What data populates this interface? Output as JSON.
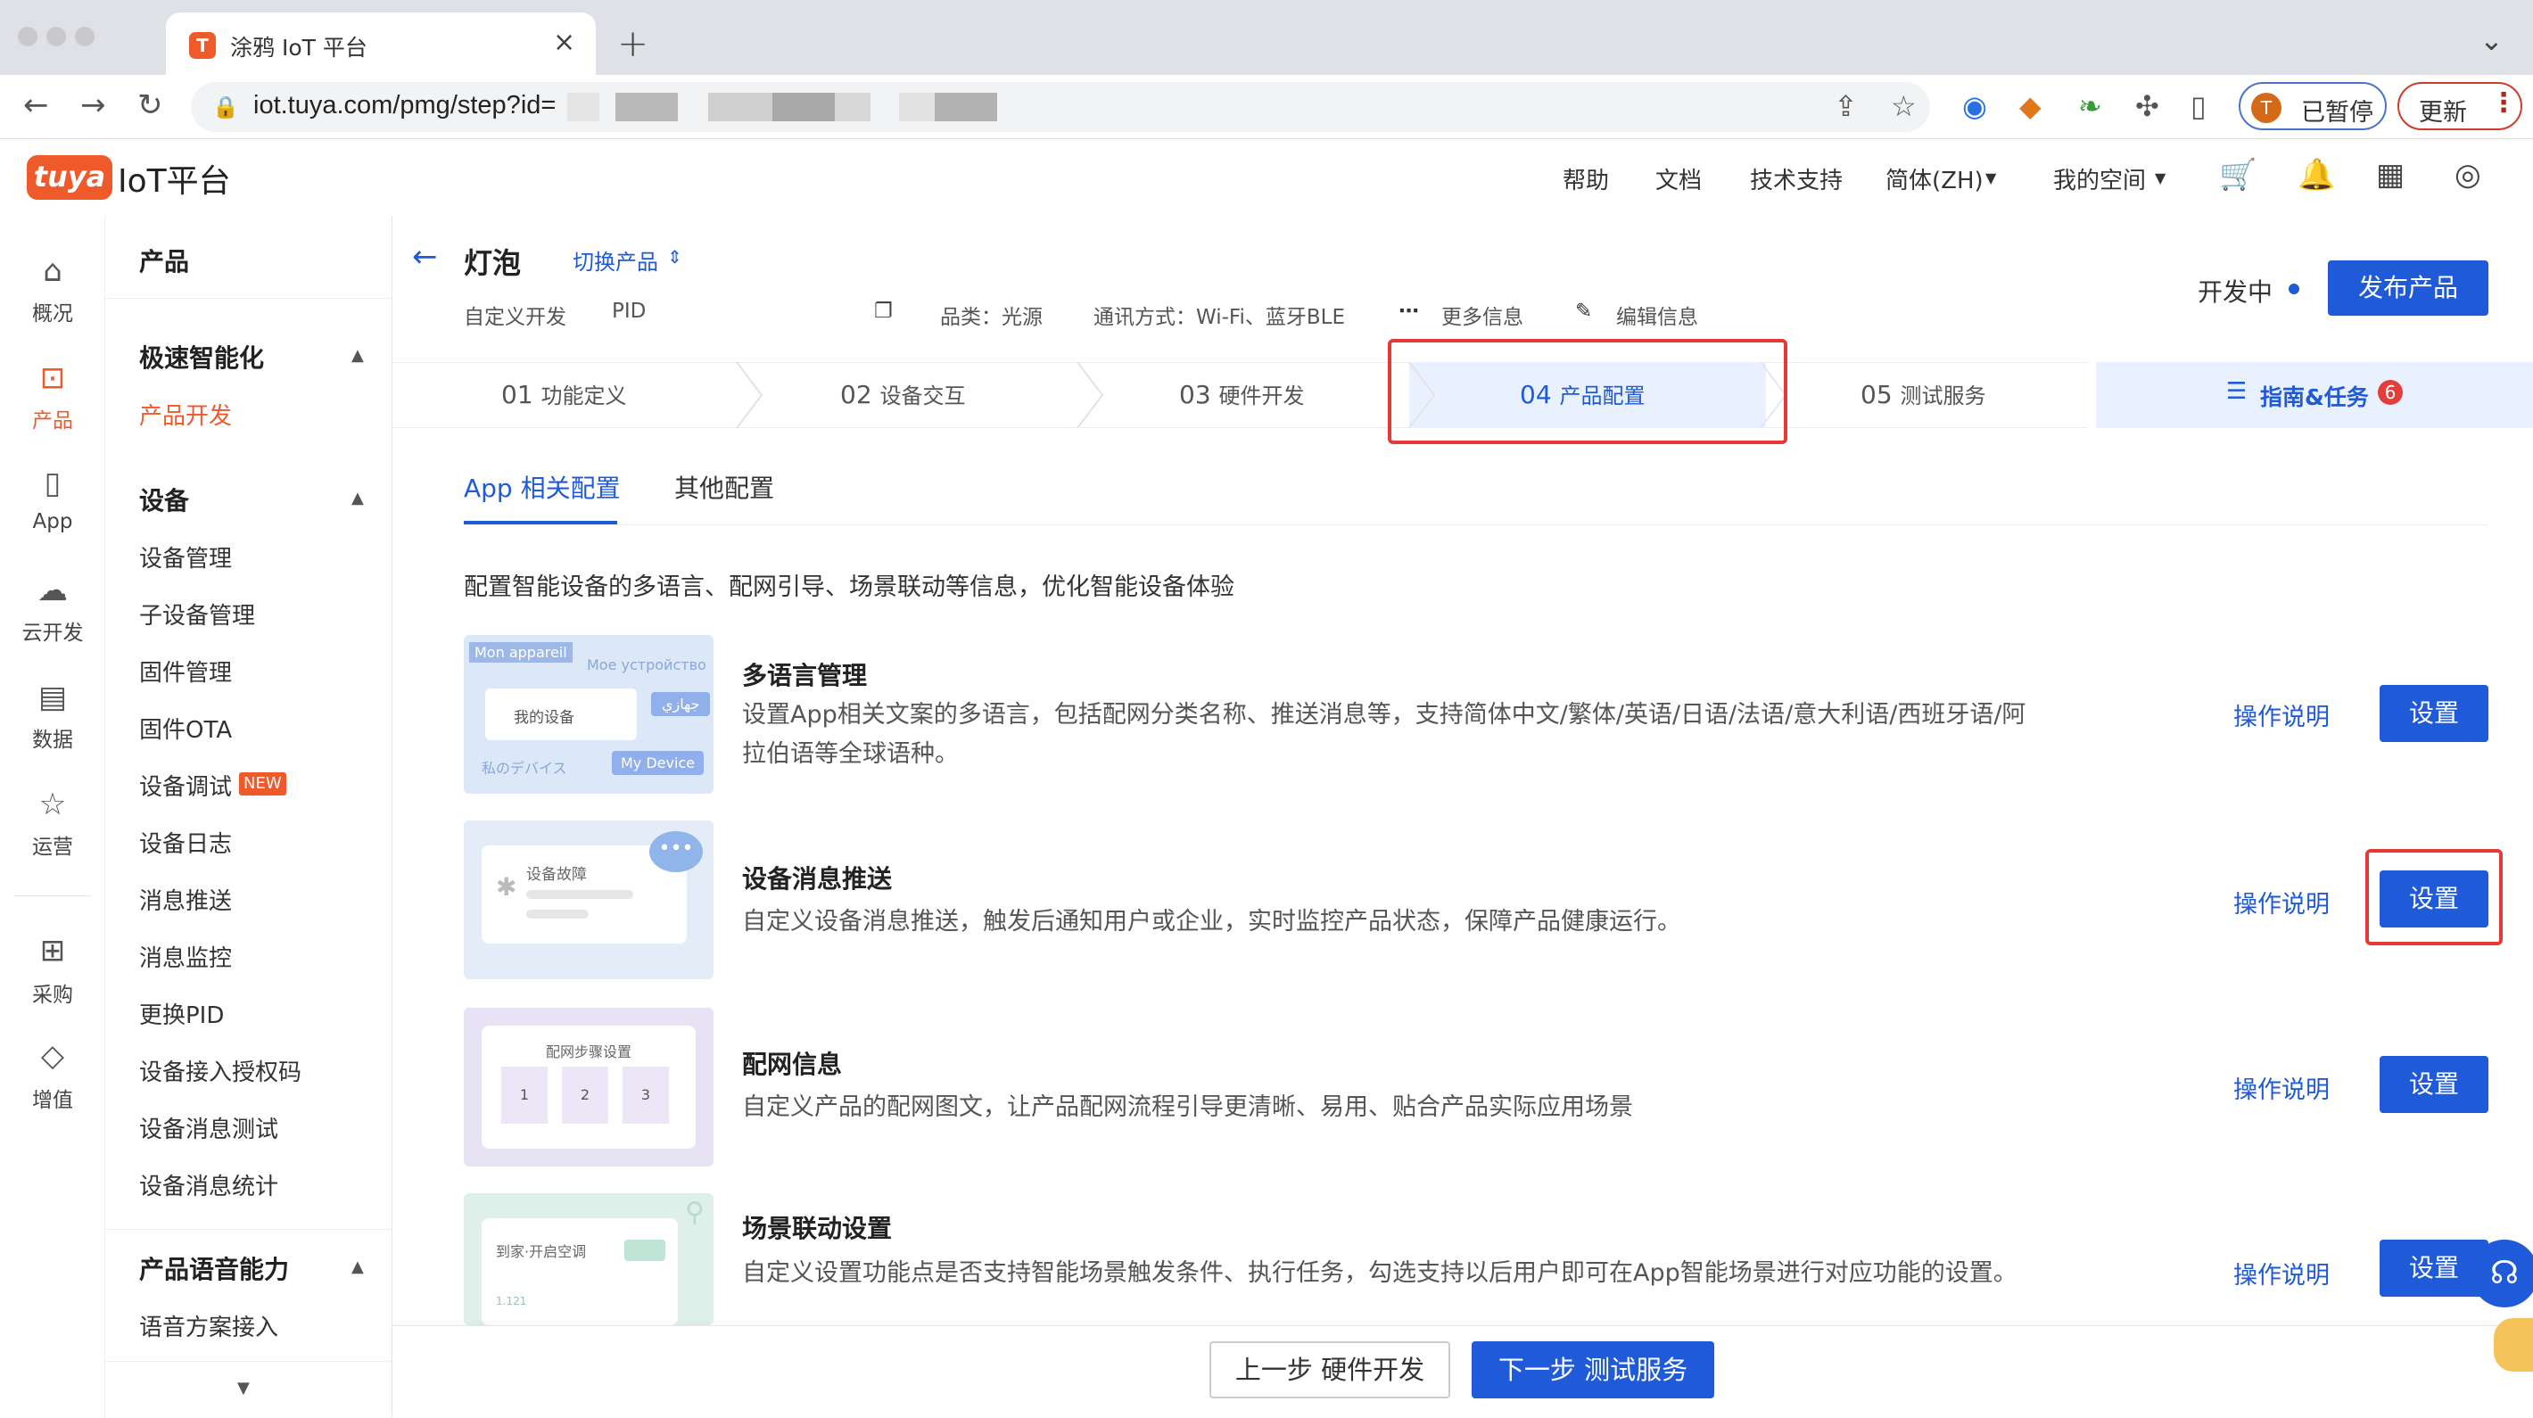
{
  "browser": {
    "tab_title": "涂鸦 IoT 平台",
    "tab_favicon": "T",
    "tab_close": "×",
    "new_tab": "+",
    "url": "iot.tuya.com/pmg/step?id=",
    "profile_initial": "T",
    "profile_status": "已暂停",
    "update_label": "更新"
  },
  "header": {
    "logo_mark": "tuya",
    "logo_text": "IoT平台",
    "nav": [
      "帮助",
      "文档",
      "技术支持",
      "简体(ZH)",
      "我的空间"
    ]
  },
  "rail": [
    {
      "label": "概况",
      "icon": "home-icon"
    },
    {
      "label": "产品",
      "icon": "terminal-icon",
      "active": true
    },
    {
      "label": "App",
      "icon": "phone-icon"
    },
    {
      "label": "云开发",
      "icon": "cloud-icon"
    },
    {
      "label": "数据",
      "icon": "chart-icon"
    },
    {
      "label": "运营",
      "icon": "star-icon"
    },
    {
      "label": "采购",
      "icon": "store-icon"
    },
    {
      "label": "增值",
      "icon": "diamond-icon"
    }
  ],
  "submenu": {
    "title": "产品",
    "group1": {
      "title": "极速智能化",
      "items": [
        "产品开发"
      ]
    },
    "group2": {
      "title": "设备",
      "items": [
        "设备管理",
        "子设备管理",
        "固件管理",
        "固件OTA",
        "设备调试",
        "设备日志",
        "消息推送",
        "消息监控",
        "更换PID",
        "设备接入授权码",
        "设备消息测试",
        "设备消息统计"
      ]
    },
    "new_badge": "NEW",
    "group3": {
      "title": "产品语音能力",
      "items": [
        "语音方案接入"
      ]
    }
  },
  "product": {
    "name": "灯泡",
    "switch_label": "切换产品",
    "dev_type": "自定义开发",
    "pid_label": "PID",
    "category": "品类：光源",
    "protocol": "通讯方式：Wi-Fi、蓝牙BLE",
    "more_info": "更多信息",
    "edit_info": "编辑信息",
    "status": "开发中",
    "publish": "发布产品"
  },
  "steps": [
    {
      "num": "01",
      "label": "功能定义"
    },
    {
      "num": "02",
      "label": "设备交互"
    },
    {
      "num": "03",
      "label": "硬件开发"
    },
    {
      "num": "04",
      "label": "产品配置"
    },
    {
      "num": "05",
      "label": "测试服务"
    }
  ],
  "active_step": 4,
  "guide": {
    "label": "指南&任务",
    "count": "6"
  },
  "subtabs": [
    "App 相关配置",
    "其他配置"
  ],
  "intro": "配置智能设备的多语言、配网引导、场景联动等信息，优化智能设备体验",
  "rows": [
    {
      "title": "多语言管理",
      "desc": "设置App相关文案的多语言，包括配网分类名称、推送消息等，支持简体中文/繁体/英语/日语/法语/意大利语/西班牙语/阿拉伯语等全球语种。",
      "link": "操作说明",
      "button": "设置"
    },
    {
      "title": "设备消息推送",
      "desc": "自定义设备消息推送，触发后通知用户或企业，实时监控产品状态，保障产品健康运行。",
      "link": "操作说明",
      "button": "设置"
    },
    {
      "title": "配网信息",
      "desc": "自定义产品的配网图文，让产品配网流程引导更清晰、易用、贴合产品实际应用场景",
      "link": "操作说明",
      "button": "设置"
    },
    {
      "title": "场景联动设置",
      "desc": "自定义设置功能点是否支持智能场景触发条件、执行任务，勾选支持以后用户即可在App智能场景进行对应功能的设置。",
      "link": "操作说明",
      "button": "设置"
    }
  ],
  "thumbs": {
    "lang": {
      "tag1": "Mon appareil",
      "tag2": "Мое устройство",
      "card": "我的设备",
      "tag3": "جهازي",
      "tag4": "私のデバイス",
      "tag5": "My Device"
    },
    "push": {
      "card": "设备故障"
    },
    "network": {
      "card": "配网步骤设置",
      "steps": [
        "1",
        "2",
        "3"
      ]
    },
    "scene": {
      "card": "到家·开启空调",
      "foot": "1.121"
    }
  },
  "footer": {
    "prev": "上一步 硬件开发",
    "next": "下一步 测试服务"
  },
  "colors": {
    "brand": "#ef5a2a",
    "primary": "#1f5bd8",
    "highlight": "#e53935"
  }
}
